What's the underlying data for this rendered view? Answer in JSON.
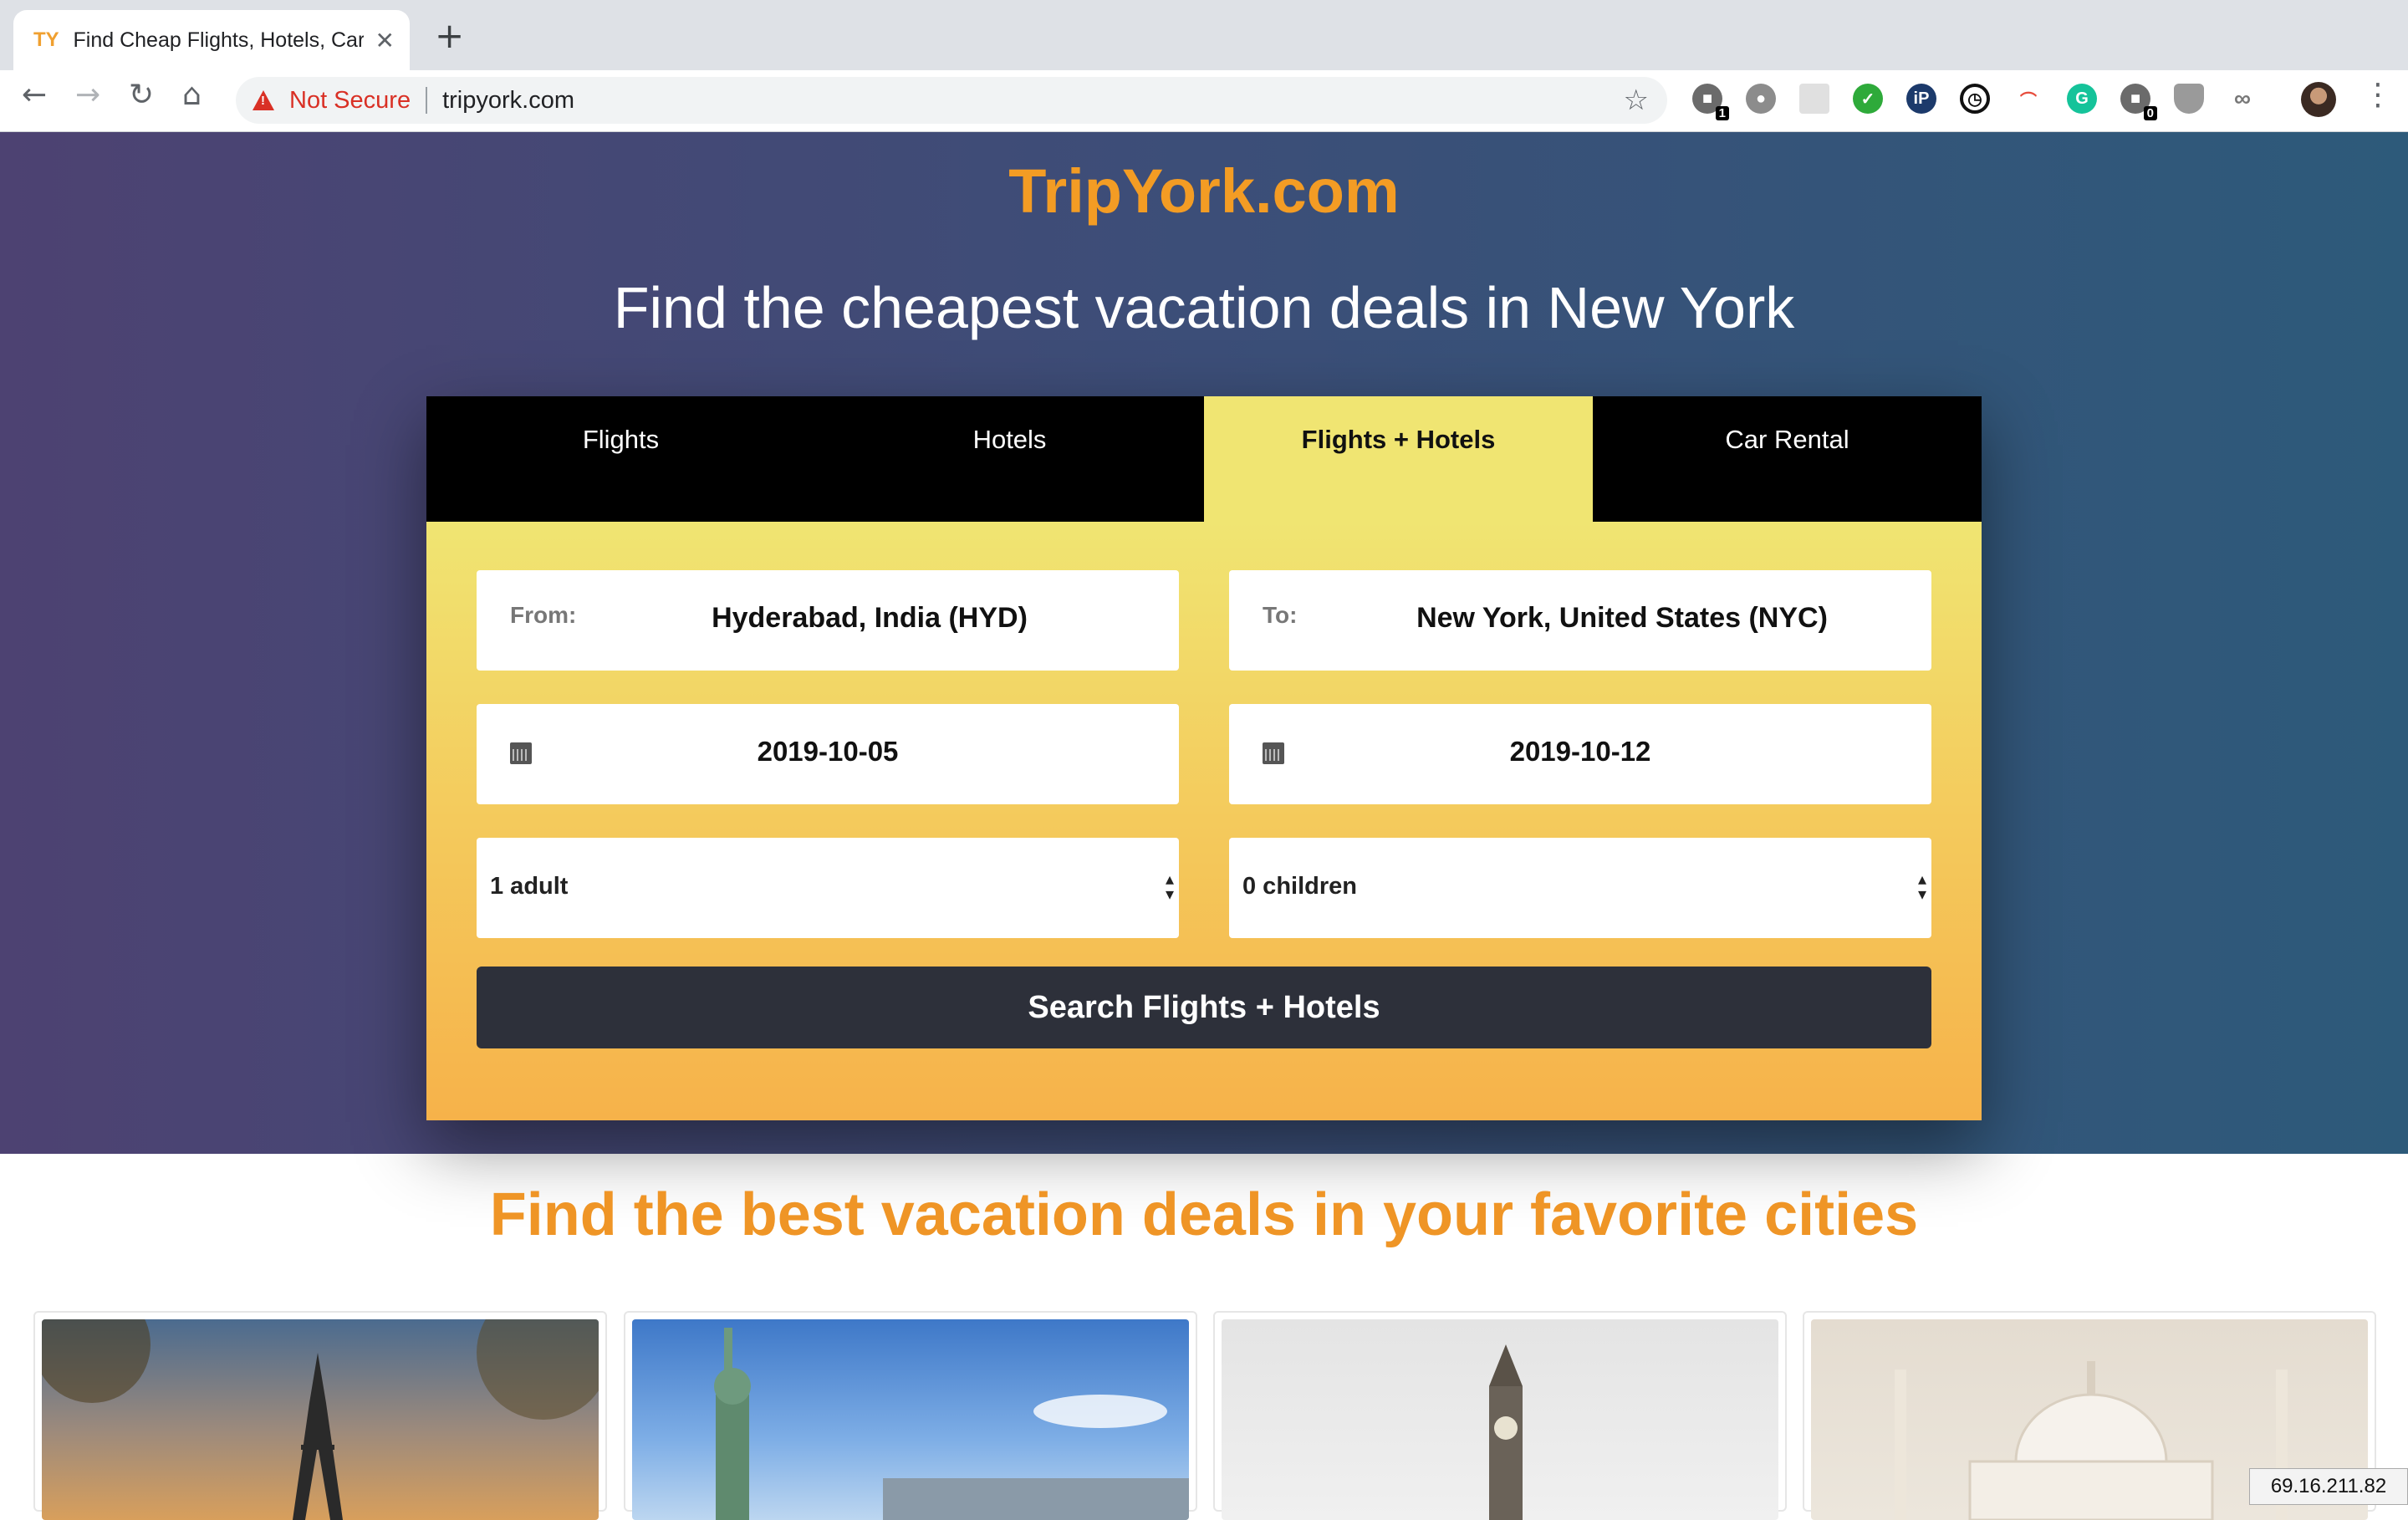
{
  "browser": {
    "tab_title": "Find Cheap Flights, Hotels, Car",
    "tab_favicon": "TY",
    "security_label": "Not Secure",
    "url": "tripyork.com",
    "extension_badges": {
      "first": "1",
      "second": "0"
    }
  },
  "page": {
    "brand": "TripYork.com",
    "headline": "Find the cheapest vacation deals in New York",
    "tabs": [
      {
        "label": "Flights",
        "active": false
      },
      {
        "label": "Hotels",
        "active": false
      },
      {
        "label": "Flights + Hotels",
        "active": true
      },
      {
        "label": "Car Rental",
        "active": false
      }
    ],
    "form": {
      "from_label": "From:",
      "from_value": "Hyderabad, India (HYD)",
      "to_label": "To:",
      "to_value": "New York, United States (NYC)",
      "depart_date": "2019-10-05",
      "return_date": "2019-10-12",
      "adults": "1 adult",
      "children": "0 children",
      "search_label": "Search Flights + Hotels"
    },
    "section_title": "Find the best vacation deals in your favorite cities",
    "cities": [
      {
        "icon": "eiffel-tower-icon"
      },
      {
        "icon": "statue-of-liberty-icon"
      },
      {
        "icon": "big-ben-icon"
      },
      {
        "icon": "taj-mahal-icon"
      }
    ],
    "ip_address": "69.16.211.82"
  },
  "colors": {
    "brand_orange": "#f39c24",
    "active_tab": "#f0e572",
    "search_button": "#2d303a",
    "security_red": "#d93025"
  }
}
